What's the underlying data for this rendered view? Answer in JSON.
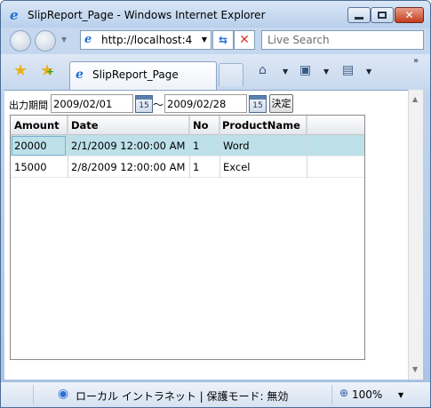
{
  "window": {
    "title": "SlipReport_Page - Windows Internet Explorer",
    "close_symbol": "✕"
  },
  "address_bar": {
    "url": "http://localhost:4",
    "search_placeholder": "Live Search"
  },
  "tabs": [
    {
      "label": "SlipReport_Page"
    }
  ],
  "toolbar": {
    "icons": [
      "favorites-star-icon",
      "add-favorites-icon",
      "home-icon",
      "feeds-icon",
      "print-icon"
    ]
  },
  "filter": {
    "label": "出力期間",
    "start_date": "2009/02/01",
    "end_date": "2009/02/28",
    "separator": "～",
    "calendar_day": "15",
    "submit_label": "決定"
  },
  "grid": {
    "columns": [
      "Amount",
      "Date",
      "No",
      "ProductName"
    ],
    "rows": [
      [
        "20000",
        "2/1/2009 12:00:00 AM",
        "1",
        "Word"
      ],
      [
        "15000",
        "2/8/2009 12:00:00 AM",
        "1",
        "Excel"
      ]
    ],
    "selected_row": 0
  },
  "status_bar": {
    "zone_text": "ローカル イントラネット | 保護モード: 無効",
    "zoom": "100%"
  },
  "colors": {
    "selected_row": "#bde0e9",
    "close_button": "#c43b1d"
  }
}
